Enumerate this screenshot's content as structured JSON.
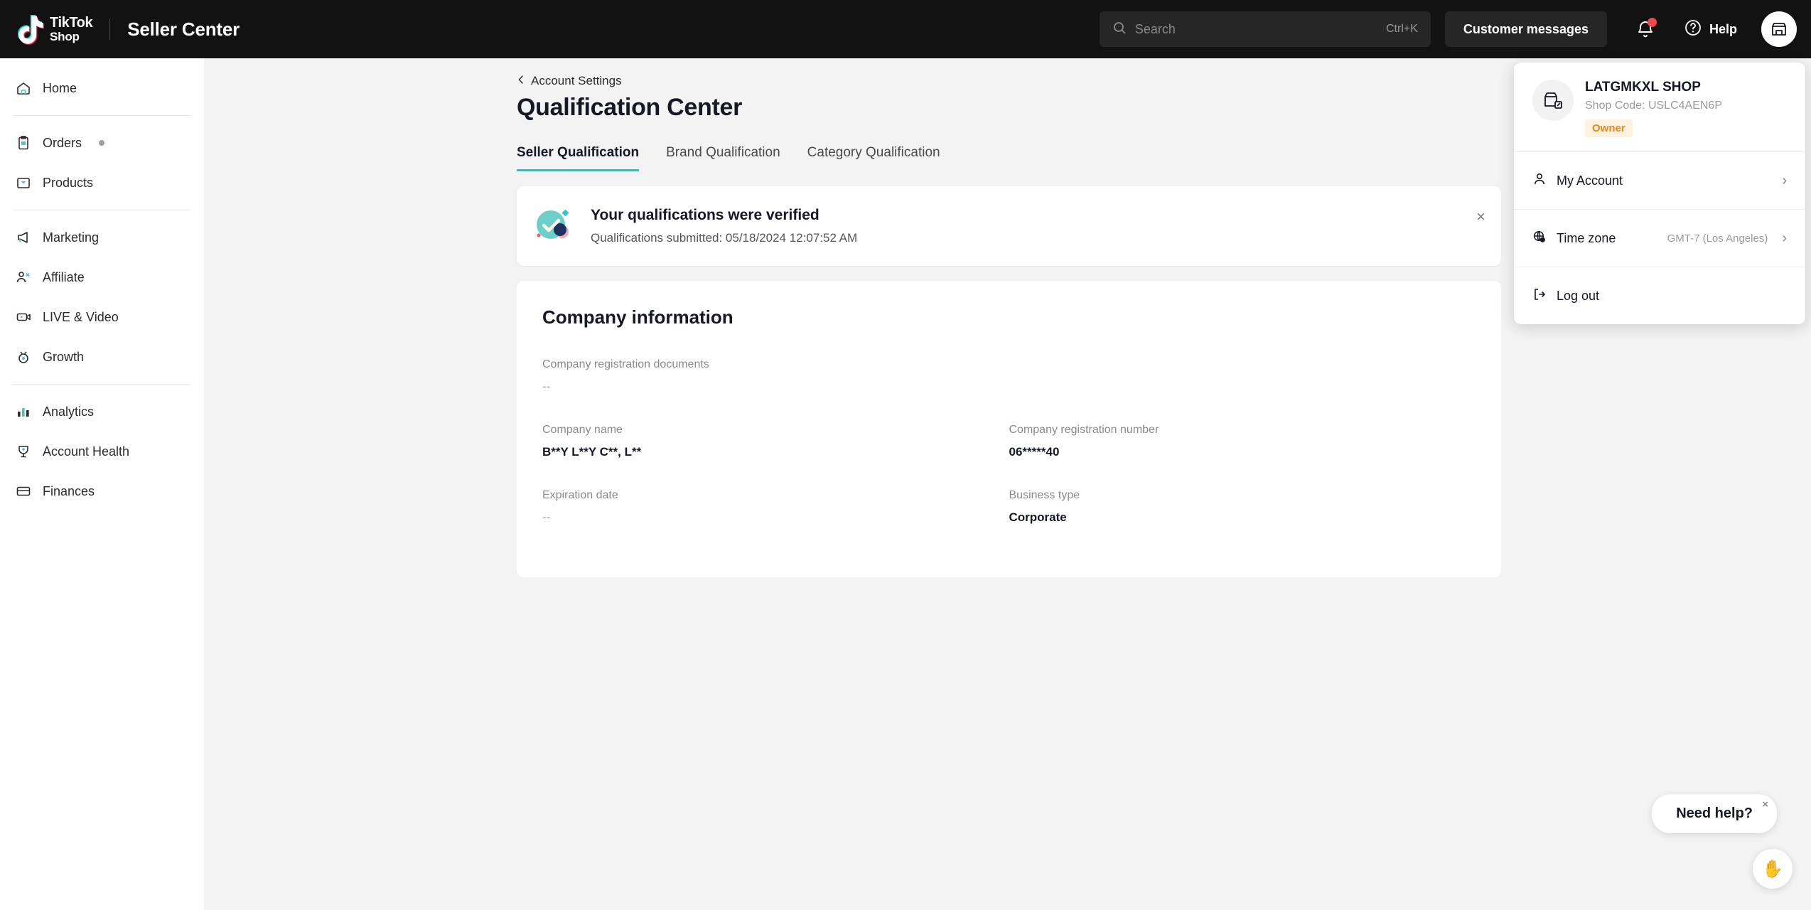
{
  "header": {
    "brand_tiktok": "TikTok",
    "brand_shop": "Shop",
    "seller_center": "Seller Center",
    "search_placeholder": "Search",
    "search_shortcut": "Ctrl+K",
    "customer_messages": "Customer messages",
    "help_label": "Help",
    "notification_badge": true
  },
  "sidebar": {
    "items": [
      {
        "label": "Home",
        "icon": "home-icon",
        "dot": false
      },
      {
        "label": "Orders",
        "icon": "orders-icon",
        "dot": true
      },
      {
        "label": "Products",
        "icon": "products-icon",
        "dot": false
      },
      {
        "label": "Marketing",
        "icon": "marketing-icon",
        "dot": false
      },
      {
        "label": "Affiliate",
        "icon": "affiliate-icon",
        "dot": false
      },
      {
        "label": "LIVE & Video",
        "icon": "live-video-icon",
        "dot": false
      },
      {
        "label": "Growth",
        "icon": "growth-icon",
        "dot": false
      },
      {
        "label": "Analytics",
        "icon": "analytics-icon",
        "dot": false
      },
      {
        "label": "Account Health",
        "icon": "account-health-icon",
        "dot": false
      },
      {
        "label": "Finances",
        "icon": "finances-icon",
        "dot": false
      }
    ]
  },
  "main": {
    "breadcrumb": "Account Settings",
    "title": "Qualification Center",
    "tabs": [
      {
        "label": "Seller Qualification",
        "active": true
      },
      {
        "label": "Brand Qualification",
        "active": false
      },
      {
        "label": "Category Qualification",
        "active": false
      }
    ],
    "banner": {
      "title": "Your qualifications were verified",
      "subtitle": "Qualifications submitted: 05/18/2024 12:07:52 AM",
      "close_label": "×"
    },
    "company_card": {
      "title": "Company information",
      "fields": [
        {
          "label": "Company registration documents",
          "value": "--",
          "muted": true
        },
        {
          "label": "Company name",
          "value": "B**Y L**Y C**, L**",
          "muted": false
        },
        {
          "label": "Company registration number",
          "value": "06*****40",
          "muted": false
        },
        {
          "label": "Expiration date",
          "value": "--",
          "muted": true
        },
        {
          "label": "Business type",
          "value": "Corporate",
          "muted": false
        }
      ]
    }
  },
  "account_panel": {
    "shop_name": "LATGMKXL SHOP",
    "shop_code": "Shop Code: USLC4AEN6P",
    "role_badge": "Owner",
    "my_account": "My Account",
    "time_zone_label": "Time zone",
    "time_zone_value": "GMT-7 (Los Angeles)",
    "log_out": "Log out"
  },
  "help_widget": {
    "bubble_text": "Need help?",
    "close_label": "×"
  },
  "colors": {
    "header_bg": "#121212",
    "accent_teal": "#4cb3ae",
    "badge_orange": "#e08c26",
    "notification_red": "#f24a4a",
    "content_bg": "#f3f3f3"
  }
}
